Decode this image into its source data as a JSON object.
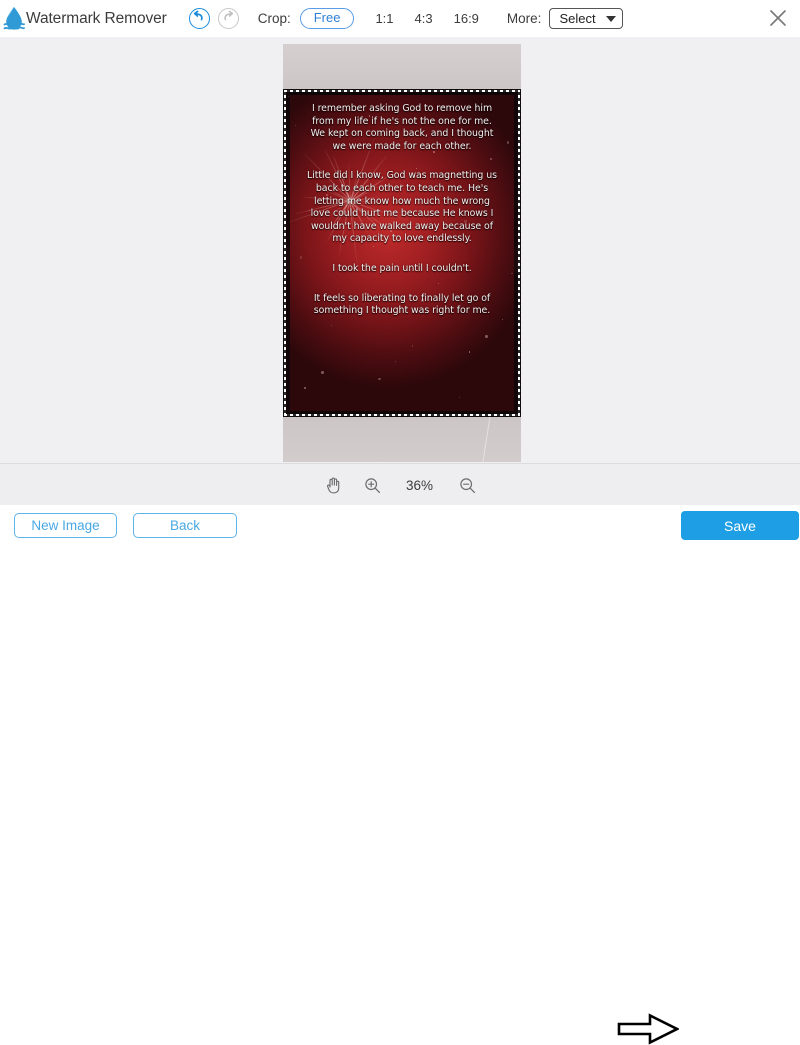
{
  "app": {
    "title": "Watermark Remover",
    "logo_icon": "water-drop-icon"
  },
  "toolbar": {
    "undo_icon": "undo-arrow-icon",
    "redo_icon": "redo-arrow-icon",
    "crop_label": "Crop:",
    "ratios": [
      "Free",
      "1:1",
      "4:3",
      "16:9"
    ],
    "active_ratio": "Free",
    "more_label": "More:",
    "select_value": "Select",
    "caret_icon": "chevron-down-icon",
    "close_icon": "close-x-icon"
  },
  "canvas": {
    "image_alt": "red fireworks background with white quote text",
    "crop_selection_active": true
  },
  "poem": {
    "paragraphs": [
      "I remember asking God to remove him from my life if he's not the one for me. We kept on coming back, and I thought we were made for each other.",
      "Little did I know, God was magnetting us back to each other to teach me. He's letting me know how much the wrong love could hurt me because He knows I wouldn't have walked away because of my capacity to love endlessly.",
      "I took the pain until I couldn't.",
      "It feels so liberating to finally let go of something I thought was right for me."
    ]
  },
  "zoombar": {
    "hand_icon": "hand-pan-icon",
    "zoom_in_icon": "zoom-in-icon",
    "zoom_level": "36%",
    "zoom_out_icon": "zoom-out-icon"
  },
  "footer": {
    "new_image_label": "New Image",
    "back_label": "Back",
    "save_label": "Save",
    "arrow_annotation_icon": "right-arrow-annotation-icon"
  },
  "colors": {
    "accent_blue": "#1e9ee5",
    "outline_blue": "#5fb4e8",
    "canvas_bg": "#f0f0f2",
    "zoombar_bg": "#eeeef0"
  }
}
